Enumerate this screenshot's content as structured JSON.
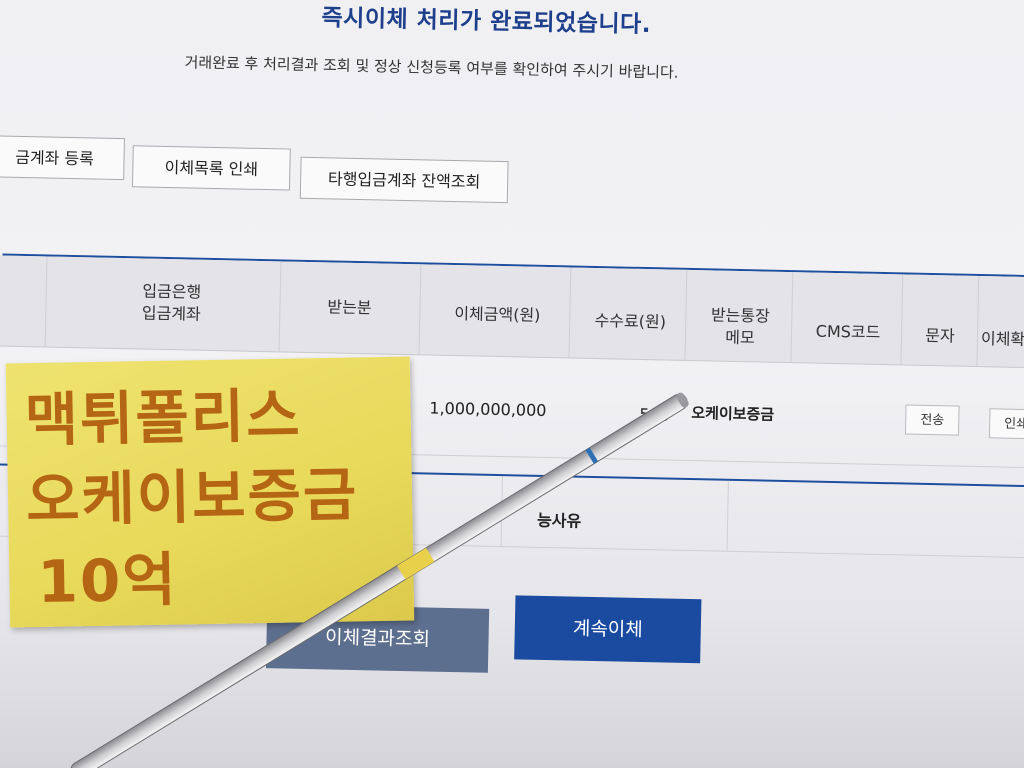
{
  "header": {
    "title": "즉시이체 처리가 완료되었습니다.",
    "subtitle": "거래완료 후 처리결과 조회 및 정상 신청등록 여부를 확인하여 주시기 바랍니다."
  },
  "actions": {
    "register_account": "금계좌 등록",
    "print_list": "이체목록 인쇄",
    "balance_check": "타행입금계좌 잔액조회"
  },
  "table": {
    "headers": {
      "bank_account_1": "입금은행",
      "bank_account_2": "입금계좌",
      "recipient": "받는분",
      "amount": "이체금액(원)",
      "fee": "수수료(원)",
      "memo_1": "받는통장",
      "memo_2": "메모",
      "cms": "CMS코드",
      "sms": "문자",
      "confirm": "이체확"
    },
    "row": {
      "amount": "1,000,000,000",
      "fee": "500",
      "memo": "오케이보증금",
      "sms_button": "전송",
      "print_button": "인쇄"
    }
  },
  "failure": {
    "reason_header": "불능사유",
    "reason_visible": "능사유"
  },
  "bottom": {
    "result_button": "이체결과조회",
    "continue_button": "계속이체"
  },
  "sticky_note": {
    "line1": "맥튀폴리스",
    "line2": "오케이보증금",
    "line3": "10억"
  },
  "colors": {
    "title": "#1d3f8c",
    "accent_line": "#1e4f9e",
    "continue_button": "#1b4ba0",
    "result_button": "#5d6f8e",
    "note": "#e8d95a",
    "note_ink": "#b56614"
  }
}
